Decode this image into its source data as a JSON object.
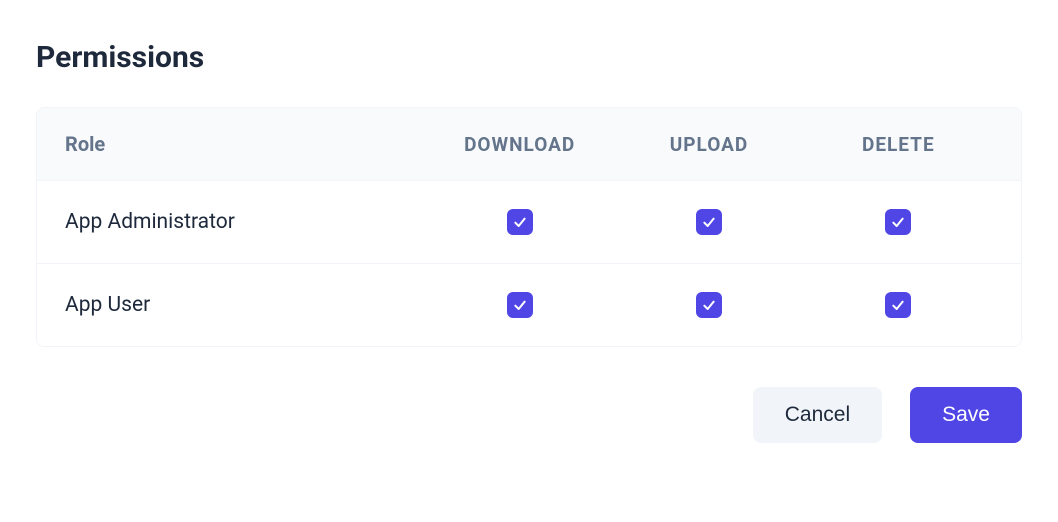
{
  "title": "Permissions",
  "table": {
    "headers": {
      "role": "Role",
      "download": "DOWNLOAD",
      "upload": "UPLOAD",
      "delete": "DELETE"
    },
    "rows": [
      {
        "role": "App Administrator",
        "download": true,
        "upload": true,
        "delete": true
      },
      {
        "role": "App User",
        "download": true,
        "upload": true,
        "delete": true
      }
    ]
  },
  "actions": {
    "cancel": "Cancel",
    "save": "Save"
  }
}
